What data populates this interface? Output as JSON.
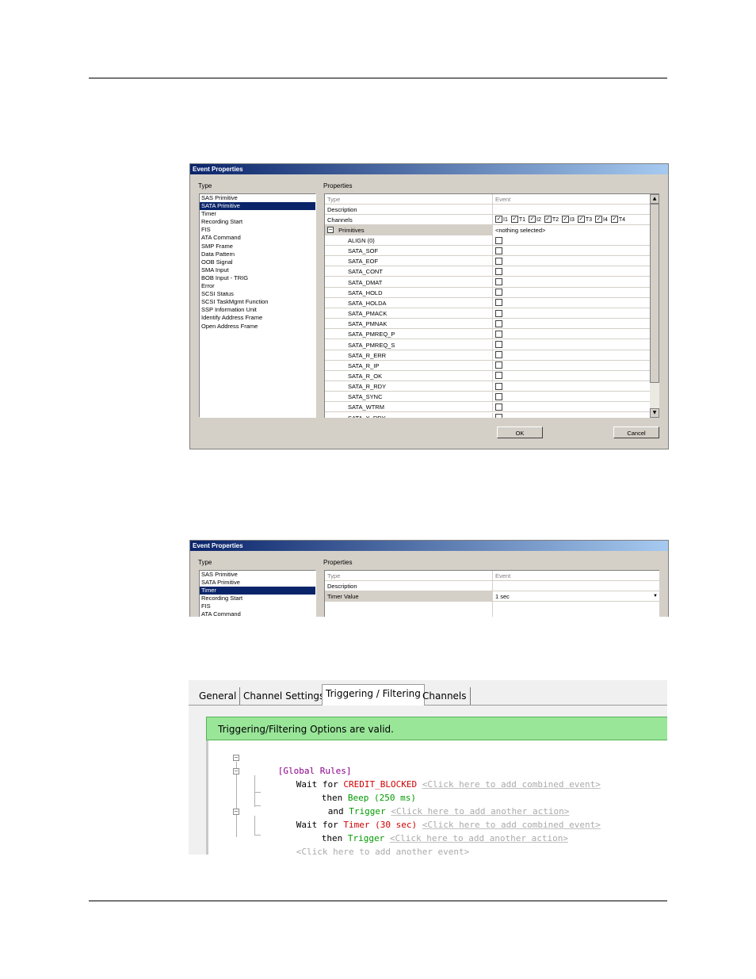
{
  "dialog1": {
    "title": "Event Properties",
    "type_label": "Type",
    "props_label": "Properties",
    "type_items": [
      "SAS Primitive",
      "SATA Primitive",
      "Timer",
      "Recording Start",
      "FIS",
      "ATA Command",
      "SMP Frame",
      "Data Pattern",
      "OOB Signal",
      "SMA Input",
      "BOB Input - TRIG",
      "Error",
      "SCSI Status",
      "SCSI TaskMgmt Function",
      "SSP Information Unit",
      "Identify Address Frame",
      "Open Address Frame"
    ],
    "selected_type": "SATA Primitive",
    "rows": {
      "type_name": "Type",
      "type_value": "Event",
      "description_name": "Description",
      "channels_name": "Channels",
      "channels": [
        "I1",
        "T1",
        "I2",
        "T2",
        "I3",
        "T3",
        "I4",
        "T4"
      ],
      "primitives_name": "Primitives",
      "primitives_value": "<nothing selected>"
    },
    "primitives": [
      "ALIGN (0)",
      "SATA_SOF",
      "SATA_EOF",
      "SATA_CONT",
      "SATA_DMAT",
      "SATA_HOLD",
      "SATA_HOLDA",
      "SATA_PMACK",
      "SATA_PMNAK",
      "SATA_PMREQ_P",
      "SATA_PMREQ_S",
      "SATA_R_ERR",
      "SATA_R_IP",
      "SATA_R_OK",
      "SATA_R_RDY",
      "SATA_SYNC",
      "SATA_WTRM",
      "SATA_X_RDY"
    ],
    "ok_label": "OK",
    "cancel_label": "Cancel"
  },
  "dialog2": {
    "title": "Event Properties",
    "type_label": "Type",
    "props_label": "Properties",
    "type_items": [
      "SAS Primitive",
      "SATA Primitive",
      "Timer",
      "Recording Start",
      "FIS",
      "ATA Command"
    ],
    "selected_type": "Timer",
    "rows": {
      "type_name": "Type",
      "type_value": "Event",
      "description_name": "Description",
      "timer_name": "Timer Value",
      "timer_value": "1 sec"
    }
  },
  "trigger_panel": {
    "tabs": [
      "General",
      "Channel Settings",
      "Triggering / Filtering",
      "Channels"
    ],
    "active_tab": "Triggering / Filtering",
    "status": "Triggering/Filtering Options are valid.",
    "global_rules": "[Global Rules]",
    "w_wait": "Wait",
    "w_for": "for",
    "w_then": "then",
    "w_and": "and",
    "ev1": "CREDIT_BLOCKED",
    "add_combined": "<Click here to add combined event>",
    "act_beep": "Beep (250 ms)",
    "act_trigger": "Trigger",
    "add_action": "<Click here to add another action>",
    "ev2": "Timer (30 sec)",
    "add_event": "<Click here to add another event>"
  },
  "colors": {
    "title_bar": "#0a246a",
    "selection": "#0a246a",
    "status_green": "#99e699",
    "keyword_red": "#d00000",
    "action_green": "#009a00",
    "rules_purple": "#8b008b"
  }
}
